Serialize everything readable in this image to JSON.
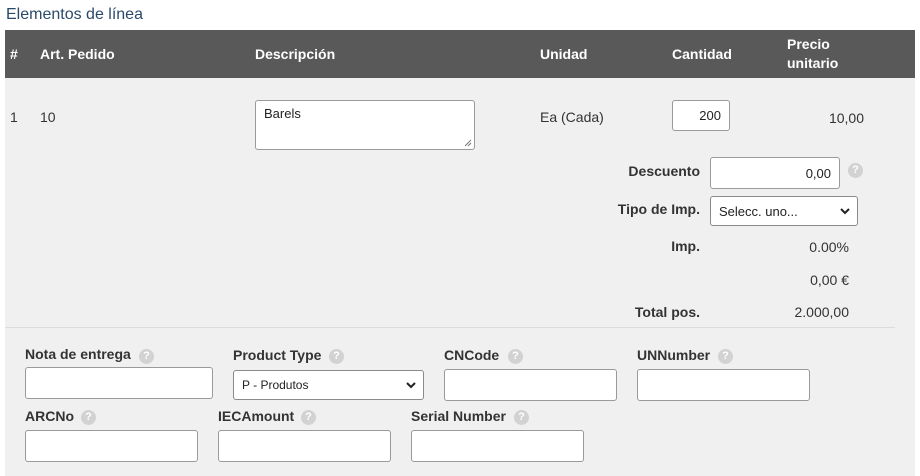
{
  "section_title": "Elementos de línea",
  "columns": {
    "num": "#",
    "art": "Art. Pedido",
    "desc": "Descripción",
    "unit": "Unidad",
    "qty": "Cantidad",
    "price_line1": "Precio",
    "price_line2": "unitario"
  },
  "line": {
    "num": "1",
    "art": "10",
    "description": "Barels",
    "unit": "Ea (Cada)",
    "quantity": "200",
    "unit_price": "10,00"
  },
  "totals": {
    "discount_label": "Descuento",
    "discount_value": "0,00",
    "tax_type_label": "Tipo de Imp.",
    "tax_type_selected": "Selecc. uno...",
    "tax_label": "Imp.",
    "tax_percent": "0.00%",
    "tax_amount": "0,00 €",
    "total_label": "Total pos.",
    "total_value": "2.000,00"
  },
  "fields": {
    "delivery_note_label": "Nota de entrega",
    "product_type_label": "Product Type",
    "product_type_selected": "P - Produtos",
    "cncode_label": "CNCode",
    "unnumber_label": "UNNumber",
    "arcno_label": "ARCNo",
    "iecamount_label": "IECAmount",
    "serial_number_label": "Serial Number"
  },
  "help_glyph": "?",
  "icons": [
    "help-icon",
    "chevron-down-icon",
    "resize-grip-icon"
  ]
}
